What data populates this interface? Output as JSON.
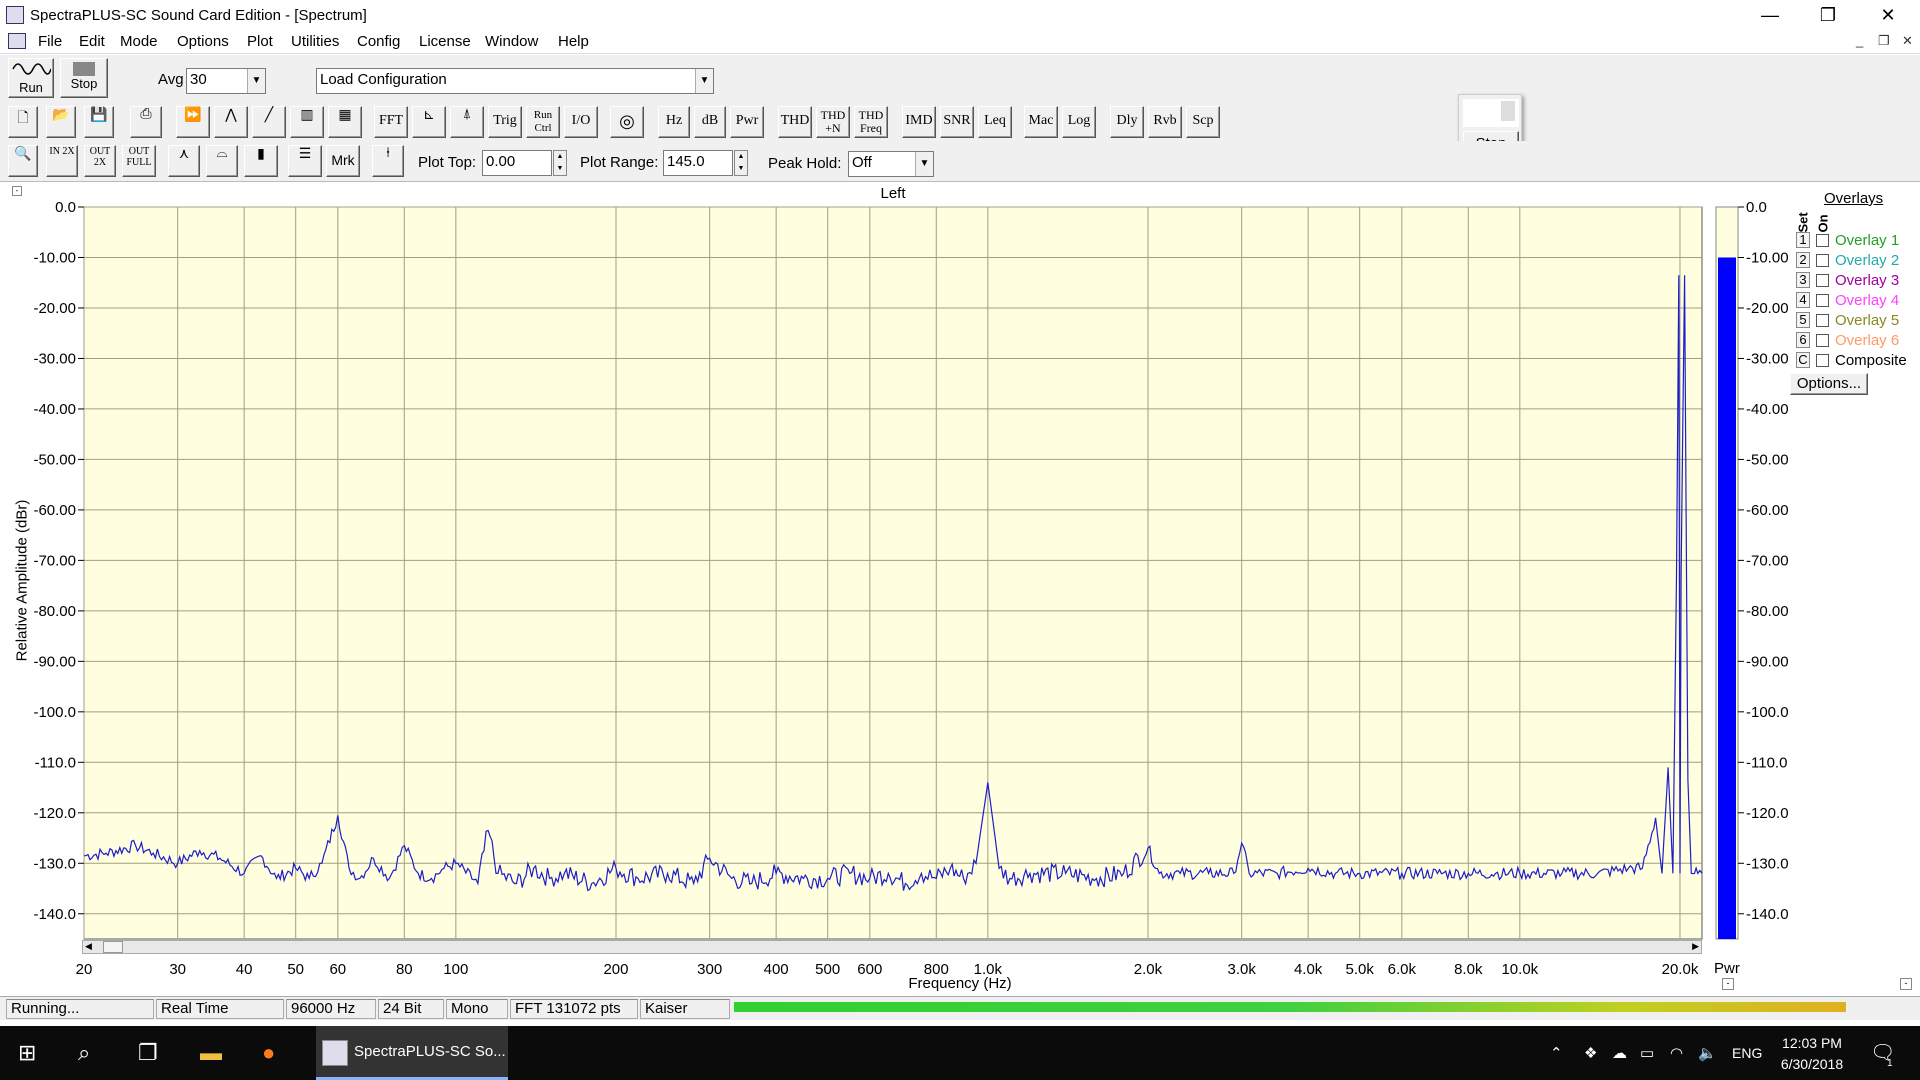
{
  "window": {
    "title": "SpectraPLUS-SC Sound Card Edition - [Spectrum]",
    "min": "—",
    "restore": "❐",
    "close": "✕"
  },
  "menu": [
    "File",
    "Edit",
    "Mode",
    "Options",
    "Plot",
    "Utilities",
    "Config",
    "License",
    "Window",
    "Help"
  ],
  "toolbar1": {
    "run": "Run",
    "stop": "Stop",
    "avg_label": "Avg",
    "avg_value": "30",
    "config_value": "Load Configuration"
  },
  "toolbar2": [
    "FFT",
    "Trig",
    "Run Ctrl",
    "I/O",
    "Hz",
    "dB",
    "Pwr",
    "THD",
    "THD +N",
    "THD Freq",
    "IMD",
    "SNR",
    "Leq",
    "Mac",
    "Log",
    "Dly",
    "Rvb",
    "Scp"
  ],
  "toolbar3": {
    "mrk": "Mrk",
    "plot_top_label": "Plot Top:",
    "plot_top_value": "0.00",
    "plot_range_label": "Plot Range:",
    "plot_range_value": "145.0",
    "peak_hold_label": "Peak Hold:",
    "peak_hold_value": "Off"
  },
  "floating": {
    "stop": "Stop"
  },
  "plot": {
    "title": "Left",
    "ylabel": "Relative Amplitude (dBr)",
    "xlabel": "Frequency (Hz)",
    "yticks": [
      "0.0",
      "-10.00",
      "-20.00",
      "-30.00",
      "-40.00",
      "-50.00",
      "-60.00",
      "-70.00",
      "-80.00",
      "-90.00",
      "-100.0",
      "-110.0",
      "-120.0",
      "-130.0",
      "-140.0"
    ],
    "xticks": [
      "20",
      "30",
      "40",
      "50",
      "60",
      "80",
      "100",
      "200",
      "300",
      "400",
      "500",
      "600",
      "800",
      "1.0k",
      "2.0k",
      "3.0k",
      "4.0k",
      "5.0k",
      "6.0k",
      "8.0k",
      "10.0k",
      "20.0k"
    ],
    "colors": {
      "background": "#ffffe0",
      "trace": "#1c1ccc",
      "grid": "#a0a080"
    }
  },
  "meter": {
    "label": "Pwr",
    "level_dbr": -10.0,
    "ticks": [
      "0.0",
      "-10.00",
      "-20.00",
      "-30.00",
      "-40.00",
      "-50.00",
      "-60.00",
      "-70.00",
      "-80.00",
      "-90.00",
      "-100.0",
      "-110.0",
      "-120.0",
      "-130.0",
      "-140.0"
    ],
    "color": "#0000ff"
  },
  "overlays": {
    "title": "Overlays",
    "set_label": "Set",
    "on_label": "On",
    "items": [
      {
        "num": "1",
        "label": "Overlay 1",
        "color": "#22a022"
      },
      {
        "num": "2",
        "label": "Overlay 2",
        "color": "#22aaaa"
      },
      {
        "num": "3",
        "label": "Overlay 3",
        "color": "#a000a0"
      },
      {
        "num": "4",
        "label": "Overlay 4",
        "color": "#ff40ff"
      },
      {
        "num": "5",
        "label": "Overlay 5",
        "color": "#888822"
      },
      {
        "num": "6",
        "label": "Overlay 6",
        "color": "#ff9966"
      },
      {
        "num": "C",
        "label": "Composite",
        "color": "#000000"
      }
    ],
    "options_button": "Options..."
  },
  "status": {
    "state": "Running...",
    "mode": "Real Time",
    "rate": "96000 Hz",
    "bits": "24 Bit",
    "channels": "Mono",
    "fft": "FFT 131072 pts",
    "window": "Kaiser"
  },
  "taskbar": {
    "app_label": "SpectraPLUS-SC So...",
    "time": "12:03 PM",
    "date": "6/30/2018",
    "lang": "ENG",
    "notif_count": "1"
  },
  "chart_data": {
    "type": "line",
    "title": "Left",
    "xlabel": "Frequency (Hz)",
    "ylabel": "Relative Amplitude (dBr)",
    "xscale": "log",
    "xlim": [
      20,
      22000
    ],
    "ylim": [
      -145,
      0
    ],
    "series": [
      {
        "x": [
          20,
          22,
          25,
          27,
          30,
          33,
          36,
          40,
          43,
          46,
          50,
          53,
          56,
          60,
          63,
          66,
          70,
          75,
          80,
          85,
          90,
          95,
          100,
          110,
          115,
          120,
          130,
          140,
          150,
          160,
          180,
          200,
          220,
          250,
          280,
          300,
          330,
          360,
          400,
          450,
          500,
          550,
          600,
          650,
          700,
          750,
          800,
          850,
          900,
          950,
          1000,
          1050,
          1100,
          1200,
          1400,
          1600,
          1800,
          2000,
          2100,
          2300,
          2600,
          2900,
          3000,
          3100,
          3500,
          4000,
          4500,
          5000,
          6000,
          7000,
          8000,
          9000,
          10000,
          12000,
          14000,
          16000,
          17000,
          18000,
          18500,
          19000,
          19400,
          19700,
          19900,
          20000,
          20100,
          20400,
          20700,
          21000,
          21300,
          21600,
          22000
        ],
        "y": [
          -128.5,
          -128,
          -126.5,
          -128,
          -130,
          -127.5,
          -129,
          -132,
          -128.5,
          -133,
          -131,
          -133,
          -130,
          -120.5,
          -131,
          -133,
          -129,
          -133,
          -126.5,
          -132,
          -133,
          -131,
          -130,
          -134,
          -123.5,
          -132,
          -134,
          -131,
          -133,
          -132,
          -134,
          -131,
          -133,
          -132,
          -134,
          -129,
          -133,
          -134,
          -132,
          -133,
          -133,
          -132,
          -133,
          -132,
          -134,
          -132,
          -133,
          -131,
          -133,
          -130,
          -114,
          -131,
          -133,
          -132,
          -132,
          -133,
          -132,
          -127,
          -132,
          -132,
          -132,
          -132,
          -126,
          -132,
          -132,
          -131,
          -132,
          -132,
          -132,
          -132,
          -132,
          -132,
          -132,
          -132,
          -132,
          -131,
          -131,
          -121,
          -132,
          -111,
          -132,
          -73,
          -13.5,
          -132,
          -73,
          -13.5,
          -113.5,
          -132,
          -132,
          -132,
          -132
        ]
      }
    ]
  }
}
